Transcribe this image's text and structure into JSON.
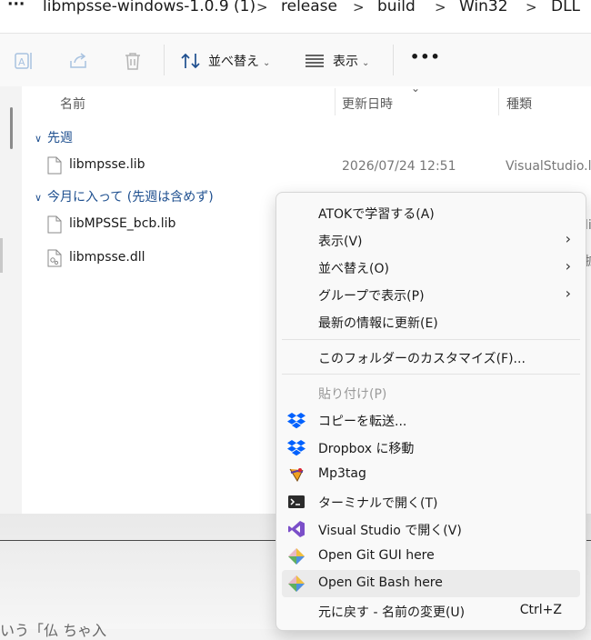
{
  "breadcrumb": {
    "more": "···",
    "items": [
      "libmpsse-windows-1.0.9 (1)",
      "release",
      "build",
      "Win32",
      "DLL"
    ],
    "separator": ">"
  },
  "toolbar": {
    "sort_label": "並べ替え",
    "view_label": "表示",
    "more": "•••",
    "chevron": "⌄"
  },
  "columns": {
    "name": "名前",
    "modified": "更新日時",
    "type": "種類",
    "sort_indicator": "⌄"
  },
  "groups": [
    {
      "label": "先週",
      "files": [
        {
          "name": "libmpsse.lib",
          "date": "2026/07/24 12:51",
          "type": "VisualStudio.li",
          "icon": "lib-file-icon"
        }
      ]
    },
    {
      "label": "今月に入って (先週は含めず)",
      "files": [
        {
          "name": "libMPSSE_bcb.lib",
          "date": "",
          "type": "li",
          "icon": "lib-file-icon"
        },
        {
          "name": "libmpsse.dll",
          "date": "",
          "type": "拡",
          "icon": "dll-file-icon"
        }
      ]
    }
  ],
  "context_menu": {
    "items": [
      {
        "label": "ATOKで学習する(A)"
      },
      {
        "label": "表示(V)",
        "submenu": true
      },
      {
        "label": "並べ替え(O)",
        "submenu": true
      },
      {
        "label": "グループで表示(P)",
        "submenu": true
      },
      {
        "label": "最新の情報に更新(E)"
      },
      {
        "label": "このフォルダーのカスタマイズ(F)..."
      },
      {
        "label": "貼り付け(P)",
        "disabled": true
      },
      {
        "label": "コピーを転送...",
        "icon": "dropbox-icon"
      },
      {
        "label": "Dropbox に移動",
        "icon": "dropbox-icon"
      },
      {
        "label": "Mp3tag",
        "icon": "mp3tag-icon"
      },
      {
        "label": "ターミナルで開く(T)",
        "icon": "terminal-icon"
      },
      {
        "label": "Visual Studio で開く(V)",
        "icon": "visual-studio-icon"
      },
      {
        "label": "Open Git GUI here",
        "icon": "git-icon"
      },
      {
        "label": "Open Git Bash here",
        "icon": "git-icon",
        "highlighted": true
      },
      {
        "label": "元に戻す - 名前の変更(U)",
        "accelerator": "Ctrl+Z"
      }
    ],
    "arrow": "›"
  },
  "lower_window": {
    "partial_text": "いう「仏 ちゃ入"
  },
  "colors": {
    "group_header": "#1e4f8f",
    "dropbox_blue": "#0061fe",
    "vs_purple": "#7b4fc9",
    "menu_bg": "#f9f9f9",
    "hover_bg": "#ebebeb"
  }
}
